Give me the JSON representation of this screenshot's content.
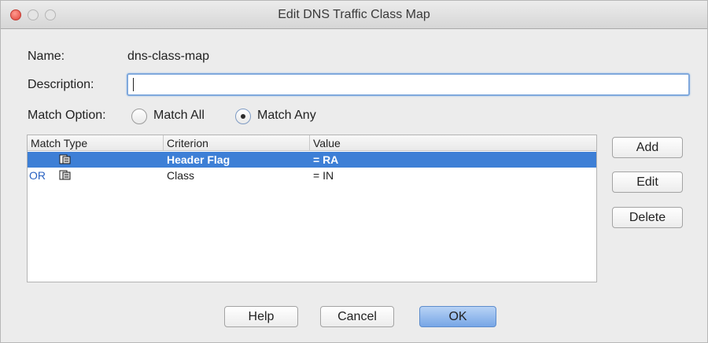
{
  "window": {
    "title": "Edit DNS Traffic Class Map"
  },
  "form": {
    "name_label": "Name:",
    "name_value": "dns-class-map",
    "description_label": "Description:",
    "description_value": "",
    "match_option_label": "Match Option:",
    "match_all_label": "Match All",
    "match_any_label": "Match Any",
    "selected_option": "Match Any"
  },
  "table": {
    "columns": [
      "Match Type",
      "Criterion",
      "Value"
    ],
    "rows": [
      {
        "match_type": "",
        "criterion": "Header Flag",
        "value": "= RA",
        "selected": true
      },
      {
        "match_type": "OR",
        "criterion": "Class",
        "value": "=  IN",
        "selected": false
      }
    ]
  },
  "side_buttons": {
    "add": "Add",
    "edit": "Edit",
    "delete": "Delete"
  },
  "footer_buttons": {
    "help": "Help",
    "cancel": "Cancel",
    "ok": "OK"
  },
  "colors": {
    "selection": "#3d7fd6",
    "ok_button": "#77a6e6",
    "or_text": "#2a62c2"
  }
}
